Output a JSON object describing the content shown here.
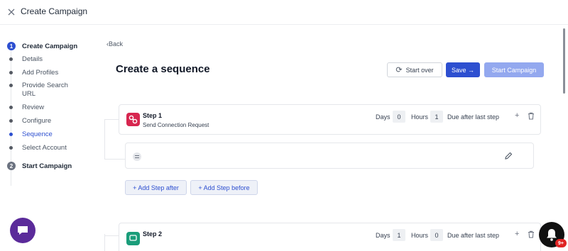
{
  "window": {
    "title": "Create Campaign"
  },
  "sidebar": {
    "steps": [
      {
        "number": "1",
        "label": "Create Campaign"
      },
      {
        "number": "2",
        "label": "Start Campaign"
      }
    ],
    "substeps": [
      {
        "label": "Details"
      },
      {
        "label": "Add Profiles"
      },
      {
        "label": "Provide Search URL"
      },
      {
        "label": "Review"
      },
      {
        "label": "Configure"
      },
      {
        "label": "Sequence",
        "active": true
      },
      {
        "label": "Select Account"
      }
    ]
  },
  "header": {
    "back": "Back",
    "title": "Create a sequence",
    "start_over": "Start over",
    "save": "Save →",
    "start_campaign": "Start Campaign"
  },
  "sequence": {
    "steps": [
      {
        "name": "Step 1",
        "action": "Send Connection Request",
        "days_label": "Days",
        "days": "0",
        "hours_label": "Hours",
        "hours": "1",
        "due": "Due after last step",
        "icon": "link-icon"
      },
      {
        "name": "Step 2",
        "action": "",
        "days_label": "Days",
        "days": "1",
        "hours_label": "Hours",
        "hours": "0",
        "due": "Due after last step",
        "icon": "message-icon"
      }
    ],
    "add_after": "+ Add Step after",
    "add_before": "+ Add Step before"
  },
  "notifications": {
    "badge": "9+"
  },
  "colors": {
    "accent": "#2d4fd0",
    "step1_icon": "#d7264f",
    "step2_icon": "#1a9d7a",
    "chat": "#5b2b9a",
    "badge": "#e02424"
  }
}
